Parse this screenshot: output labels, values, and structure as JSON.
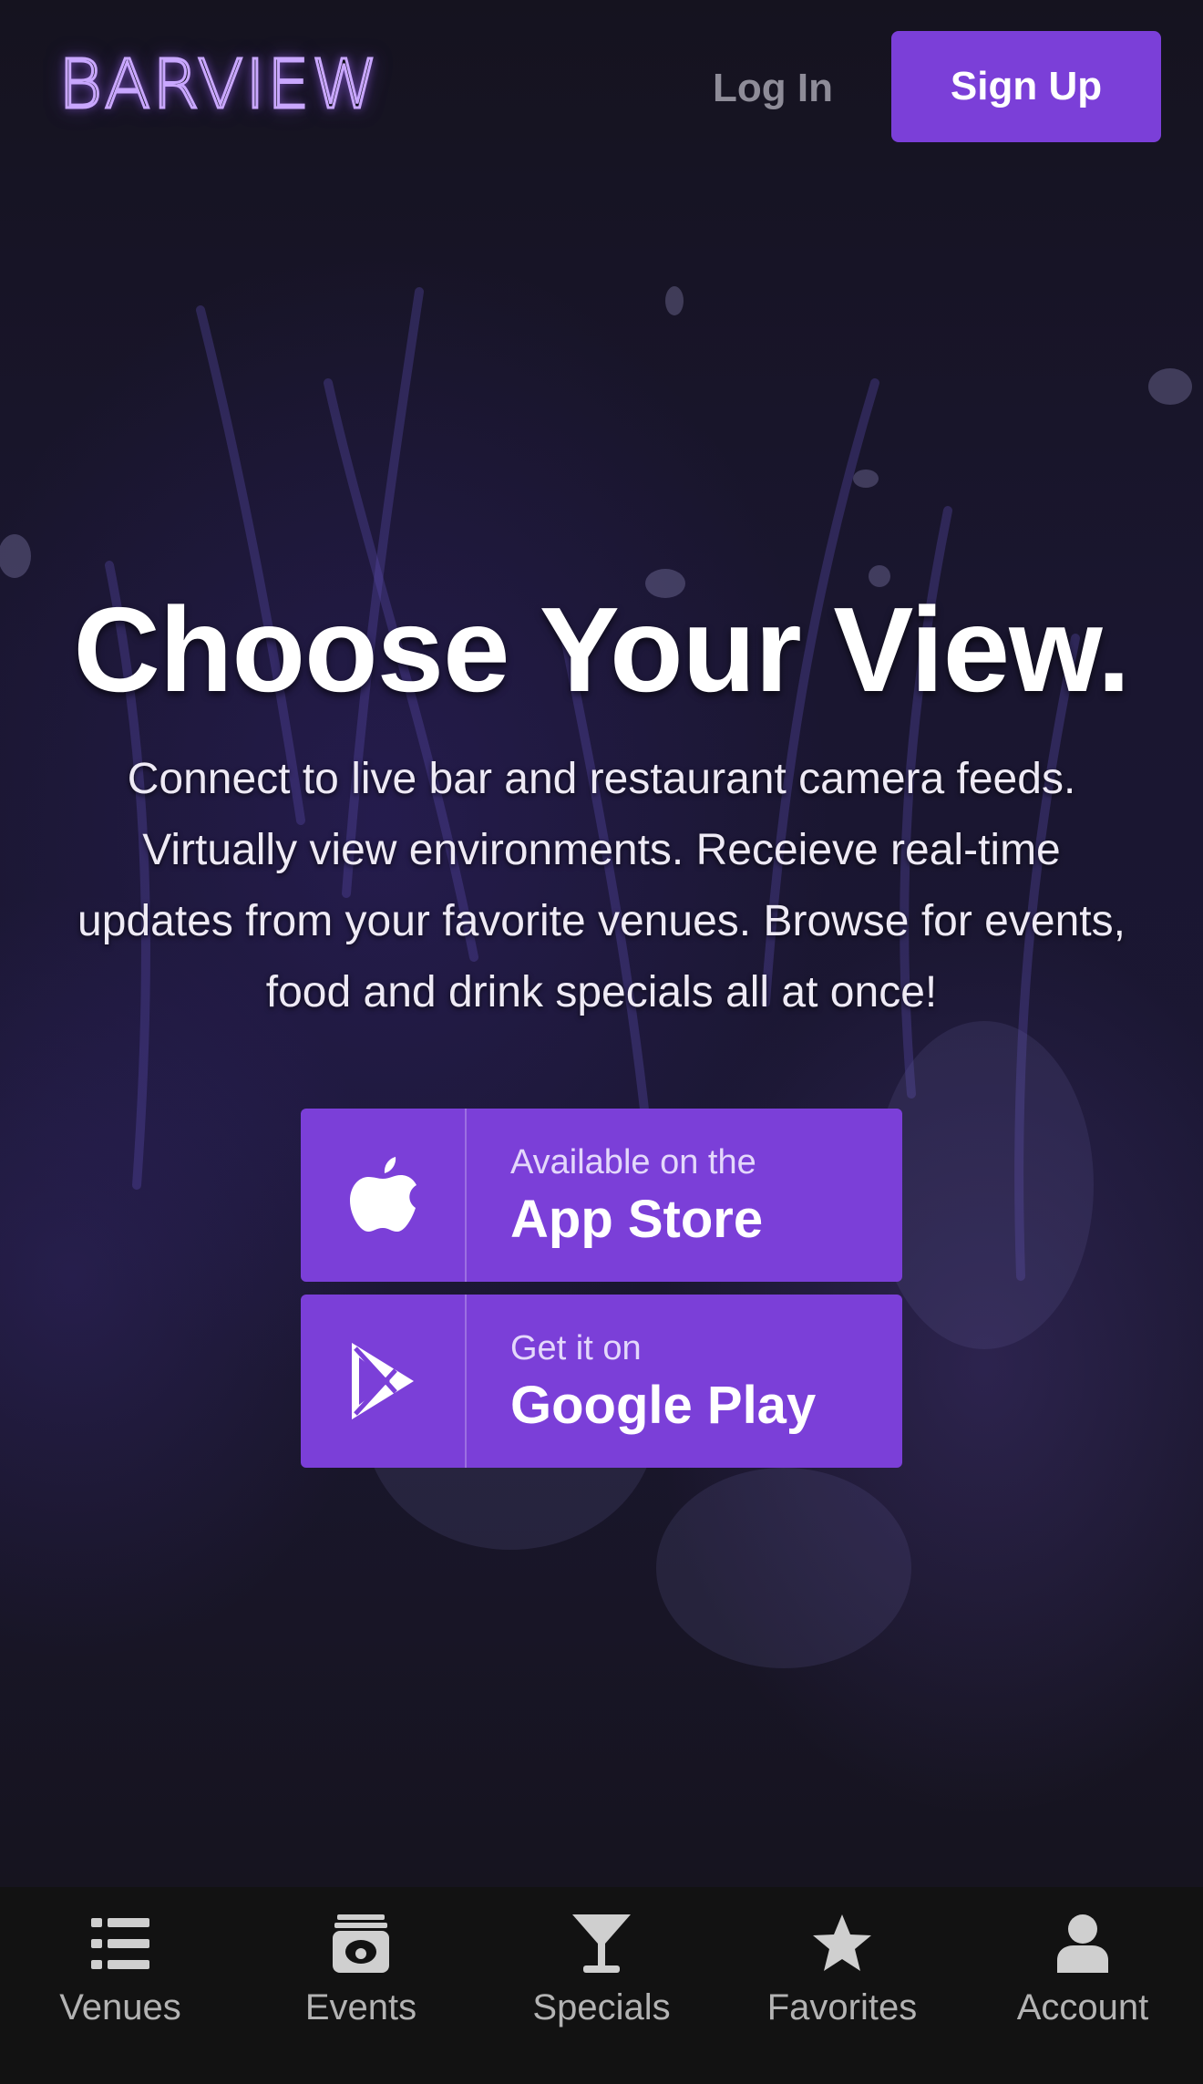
{
  "header": {
    "logo_text": "BARVIEW",
    "login_label": "Log In",
    "signup_label": "Sign Up"
  },
  "hero": {
    "headline": "Choose Your View.",
    "subtext": "Connect to live bar and restaurant camera feeds. Virtually view environments. Receieve real-time updates from your favorite venues. Browse for events, food and drink specials all at once!",
    "app_store": {
      "small_label": "Available on the",
      "big_label": "App Store",
      "icon": "apple-icon"
    },
    "google_play": {
      "small_label": "Get it on",
      "big_label": "Google Play",
      "icon": "play-store-icon"
    }
  },
  "bottom_nav": {
    "items": [
      {
        "label": "Venues",
        "icon": "list-icon"
      },
      {
        "label": "Events",
        "icon": "events-icon"
      },
      {
        "label": "Specials",
        "icon": "cocktail-icon"
      },
      {
        "label": "Favorites",
        "icon": "star-icon"
      },
      {
        "label": "Account",
        "icon": "user-icon"
      }
    ]
  },
  "colors": {
    "accent": "#7b3fd8",
    "background": "#13121c",
    "nav_background": "#121212",
    "logo_glow": "#c9a7ff"
  }
}
